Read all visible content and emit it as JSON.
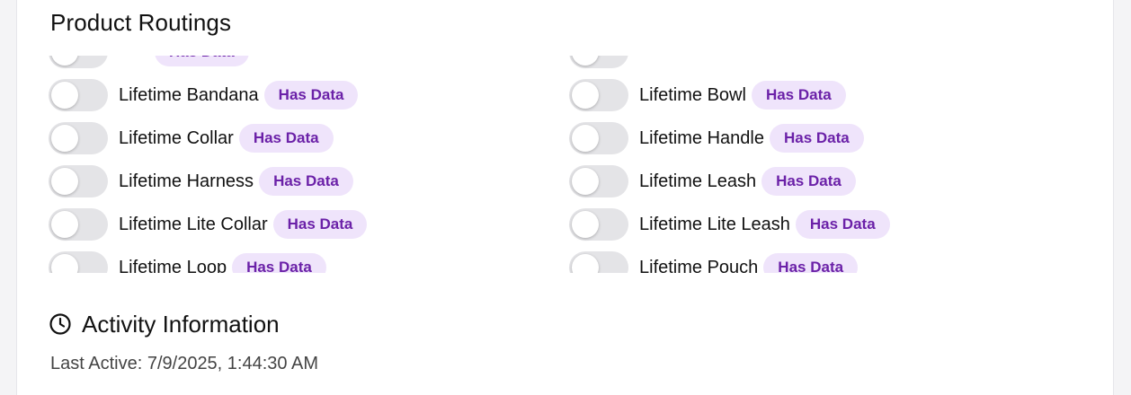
{
  "section_title": "Product Routings",
  "badge_label": "Has Data",
  "routings_left": [
    {
      "label": "",
      "has_data": true
    },
    {
      "label": "Lifetime Bandana",
      "has_data": true
    },
    {
      "label": "Lifetime Collar",
      "has_data": true
    },
    {
      "label": "Lifetime Harness",
      "has_data": true
    },
    {
      "label": "Lifetime Lite Collar",
      "has_data": true
    },
    {
      "label": "Lifetime Loop",
      "has_data": true
    }
  ],
  "routings_right": [
    {
      "label": "",
      "has_data": false
    },
    {
      "label": "Lifetime Bowl",
      "has_data": true
    },
    {
      "label": "Lifetime Handle",
      "has_data": true
    },
    {
      "label": "Lifetime Leash",
      "has_data": true
    },
    {
      "label": "Lifetime Lite Leash",
      "has_data": true
    },
    {
      "label": "Lifetime Pouch",
      "has_data": true
    }
  ],
  "activity": {
    "title": "Activity Information",
    "icon": "clock-icon",
    "last_active": "Last Active: 7/9/2025, 1:44:30 AM"
  },
  "colors": {
    "badge_bg": "#efe4fb",
    "badge_text": "#6b21a8",
    "toggle_off": "#e4e4e7"
  }
}
